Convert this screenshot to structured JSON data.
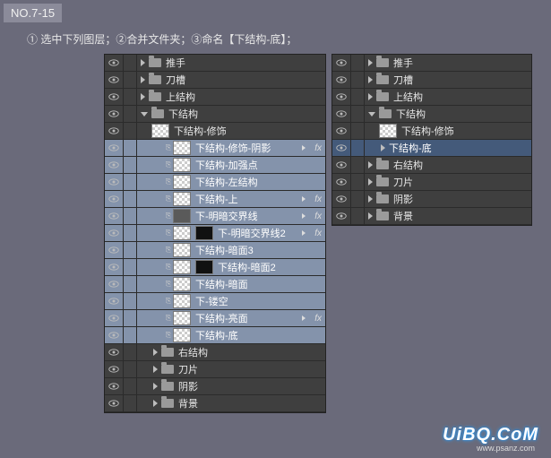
{
  "header": {
    "tag": "NO.7-15"
  },
  "instructions": "① 选中下列图层；②合并文件夹；③命名【下结构-底】；",
  "watermark": "UiBQ.CoM",
  "watermark2": "www.psanz.com",
  "left_panel": {
    "rows": [
      {
        "type": "folder",
        "label": "推手",
        "expanded": false,
        "indent": 0
      },
      {
        "type": "folder",
        "label": "刀槽",
        "expanded": false,
        "indent": 0
      },
      {
        "type": "folder",
        "label": "上结构",
        "expanded": false,
        "indent": 0
      },
      {
        "type": "folder",
        "label": "下结构",
        "expanded": true,
        "indent": 0
      },
      {
        "type": "layer",
        "label": "下结构-修饰",
        "indent": 1,
        "thumb": "check"
      },
      {
        "type": "layer",
        "label": "下结构-修饰-阴影",
        "indent": 2,
        "thumb": "check",
        "link": true,
        "selected": true,
        "fx": true
      },
      {
        "type": "layer",
        "label": "下结构-加强点",
        "indent": 2,
        "thumb": "check",
        "link": true,
        "selected": true
      },
      {
        "type": "layer",
        "label": "下结构-左结构",
        "indent": 2,
        "thumb": "check",
        "link": true,
        "selected": true
      },
      {
        "type": "layer",
        "label": "下结构-上",
        "indent": 2,
        "thumb": "check",
        "link": true,
        "selected": true,
        "fx": true
      },
      {
        "type": "layer",
        "label": "下-明暗交界线",
        "indent": 2,
        "thumb": "grey",
        "link": true,
        "selected": true,
        "fx": true
      },
      {
        "type": "layer",
        "label": "下-明暗交界线2",
        "indent": 2,
        "thumb": "mask",
        "link": true,
        "selected": true,
        "fx": true
      },
      {
        "type": "layer",
        "label": "下结构-暗面3",
        "indent": 2,
        "thumb": "check",
        "link": true,
        "selected": true
      },
      {
        "type": "layer",
        "label": "下结构-暗面2",
        "indent": 2,
        "thumb": "mask2",
        "link": true,
        "selected": true
      },
      {
        "type": "layer",
        "label": "下结构-暗面",
        "indent": 2,
        "thumb": "check",
        "link": true,
        "selected": true
      },
      {
        "type": "layer",
        "label": "下-镂空",
        "indent": 2,
        "thumb": "check",
        "link": true,
        "selected": true
      },
      {
        "type": "layer",
        "label": "下结构-亮面",
        "indent": 2,
        "thumb": "check",
        "link": true,
        "selected": true,
        "fx": true
      },
      {
        "type": "layer",
        "label": "下结构-底",
        "indent": 2,
        "thumb": "check",
        "link": true,
        "selected": true
      },
      {
        "type": "folder",
        "label": "右结构",
        "expanded": false,
        "indent": 1
      },
      {
        "type": "folder",
        "label": "刀片",
        "expanded": false,
        "indent": 1
      },
      {
        "type": "folder",
        "label": "阴影",
        "expanded": false,
        "indent": 1
      },
      {
        "type": "folder",
        "label": "背景",
        "expanded": false,
        "indent": 1
      }
    ]
  },
  "right_panel": {
    "rows": [
      {
        "type": "folder",
        "label": "推手",
        "expanded": false,
        "indent": 0
      },
      {
        "type": "folder",
        "label": "刀槽",
        "expanded": false,
        "indent": 0
      },
      {
        "type": "folder",
        "label": "上结构",
        "expanded": false,
        "indent": 0
      },
      {
        "type": "folder",
        "label": "下结构",
        "expanded": true,
        "indent": 0
      },
      {
        "type": "layer",
        "label": "下结构-修饰",
        "indent": 1,
        "thumb": "check"
      },
      {
        "type": "layer",
        "label": "下结构-底",
        "indent": 1,
        "thumb": "none",
        "selecteddark": true,
        "arrow": true
      },
      {
        "type": "folder",
        "label": "右结构",
        "expanded": false,
        "indent": 0
      },
      {
        "type": "folder",
        "label": "刀片",
        "expanded": false,
        "indent": 0
      },
      {
        "type": "folder",
        "label": "阴影",
        "expanded": false,
        "indent": 0
      },
      {
        "type": "folder",
        "label": "背景",
        "expanded": false,
        "indent": 0
      }
    ]
  }
}
